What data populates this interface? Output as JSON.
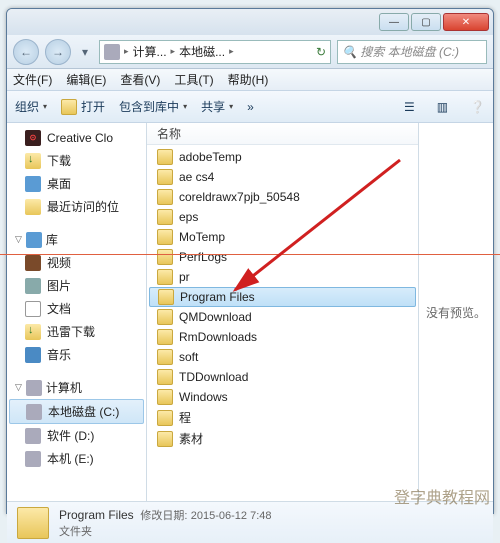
{
  "titlebar": {
    "min": "—",
    "max": "▢",
    "close": "✕"
  },
  "nav": {
    "back": "←",
    "fwd": "→",
    "segs": [
      "计算...",
      "本地磁..."
    ],
    "refresh": "↻",
    "search_placeholder": "搜索 本地磁盘 (C:)"
  },
  "menu": {
    "file": "文件(F)",
    "edit": "编辑(E)",
    "view": "查看(V)",
    "tools": "工具(T)",
    "help": "帮助(H)"
  },
  "toolbar": {
    "org": "组织",
    "open": "打开",
    "include": "包含到库中",
    "share": "共享",
    "arrow": "▾",
    "more": "»"
  },
  "navpane": {
    "cc": "Creative Clo",
    "dl": "下载",
    "desk": "桌面",
    "recent": "最近访问的位",
    "lib": "库",
    "vid": "视频",
    "pic": "图片",
    "doc": "文档",
    "tdl": "迅雷下载",
    "mus": "音乐",
    "comp": "计算机",
    "c": "本地磁盘 (C:)",
    "d": "软件 (D:)",
    "e": "本机 (E:)"
  },
  "list": {
    "header": "名称",
    "items": [
      "adobeTemp",
      "ae cs4",
      "coreldrawx7pjb_50548",
      "eps",
      "MoTemp",
      "PerfLogs",
      "pr",
      "Program Files",
      "QMDownload",
      "RmDownloads",
      "soft",
      "TDDownload",
      "Windows",
      "程",
      "素材"
    ],
    "selected_index": 7
  },
  "preview": {
    "text": "没有预览。"
  },
  "status": {
    "name": "Program Files",
    "mod_label": "修改日期:",
    "mod_value": "2015-06-12 7:48",
    "type": "文件夹"
  },
  "watermark": "登字典教程网",
  "watermark2": ""
}
